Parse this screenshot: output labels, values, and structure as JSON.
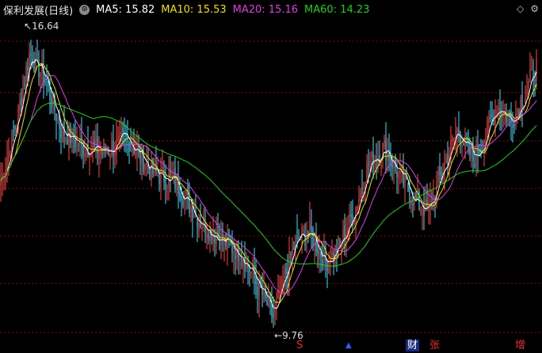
{
  "header": {
    "title": "保利发展(日线)",
    "ma_labels": [
      {
        "text": "MA5: 15.82",
        "color": "#ffffff"
      },
      {
        "text": "MA10: 15.53",
        "color": "#f0e000"
      },
      {
        "text": "MA20: 15.16",
        "color": "#e040e0"
      },
      {
        "text": "MA60: 14.23",
        "color": "#20d020"
      }
    ]
  },
  "annotations": {
    "high": "16.64",
    "low": "9.76"
  },
  "events": [
    {
      "text": "S",
      "color": "#e83030"
    },
    {
      "text": "▲",
      "color": "#3060ff"
    },
    {
      "text": "财",
      "color": "#4070ff"
    },
    {
      "text": "张",
      "color": "#e83030"
    },
    {
      "text": "增",
      "color": "#e83030"
    }
  ],
  "colors": {
    "up": "#ff4a4a",
    "down": "#40e0ff",
    "grid": "#7a1010",
    "ma5": "#ffffff",
    "ma10": "#f0e000",
    "ma20": "#e040e0",
    "ma60": "#20d020"
  },
  "chart_data": {
    "type": "candlestick",
    "ylim": [
      9.5,
      17.0
    ],
    "anchors": [
      [
        0,
        13.2
      ],
      [
        10,
        14.6
      ],
      [
        18,
        16.2
      ],
      [
        28,
        15.6
      ],
      [
        38,
        14.4
      ],
      [
        52,
        14.0
      ],
      [
        66,
        13.9
      ],
      [
        80,
        14.2
      ],
      [
        96,
        13.4
      ],
      [
        110,
        13.2
      ],
      [
        125,
        12.3
      ],
      [
        140,
        11.8
      ],
      [
        152,
        11.5
      ],
      [
        164,
        10.6
      ],
      [
        172,
        10.0
      ],
      [
        178,
        10.8
      ],
      [
        186,
        11.8
      ],
      [
        195,
        12.0
      ],
      [
        205,
        11.3
      ],
      [
        214,
        11.7
      ],
      [
        224,
        12.6
      ],
      [
        232,
        13.6
      ],
      [
        242,
        14.0
      ],
      [
        252,
        13.3
      ],
      [
        262,
        12.7
      ],
      [
        270,
        12.5
      ],
      [
        278,
        13.4
      ],
      [
        288,
        14.4
      ],
      [
        298,
        13.7
      ],
      [
        305,
        14.2
      ],
      [
        313,
        15.0
      ],
      [
        322,
        14.6
      ],
      [
        330,
        15.2
      ],
      [
        338,
        15.9
      ]
    ],
    "ma5_last": 15.82,
    "ma10_last": 15.53,
    "ma20_last": 15.16,
    "ma60_last": 14.23
  }
}
